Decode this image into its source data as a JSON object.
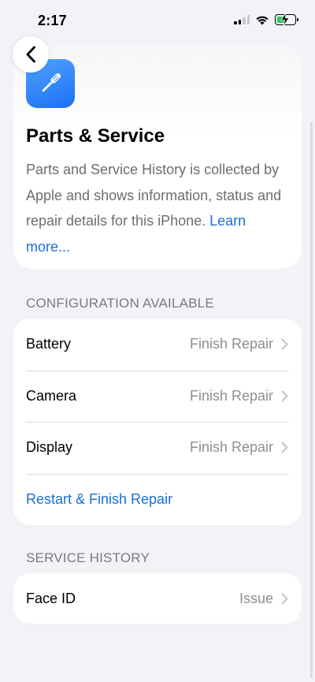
{
  "status_bar": {
    "time": "2:17"
  },
  "header": {
    "title": "Parts & Service",
    "description": "Parts and Service History is collected by Apple and shows information, status and repair details for this iPhone. ",
    "learn_more": "Learn more..."
  },
  "configuration": {
    "section_title": "CONFIGURATION AVAILABLE",
    "items": [
      {
        "label": "Battery",
        "value": "Finish Repair"
      },
      {
        "label": "Camera",
        "value": "Finish Repair"
      },
      {
        "label": "Display",
        "value": "Finish Repair"
      }
    ],
    "action_label": "Restart & Finish Repair"
  },
  "service_history": {
    "section_title": "SERVICE HISTORY",
    "items": [
      {
        "label": "Face ID",
        "value": "Issue"
      }
    ]
  },
  "colors": {
    "accent": "#1a6fd6",
    "background": "#f2f2f7",
    "secondary_text": "#8e8e93",
    "battery_charge": "#34c759"
  },
  "icons": [
    "back-chevron-icon",
    "cellular-signal-icon",
    "wifi-icon",
    "battery-charging-icon",
    "screwdriver-icon",
    "chevron-right-icon"
  ]
}
